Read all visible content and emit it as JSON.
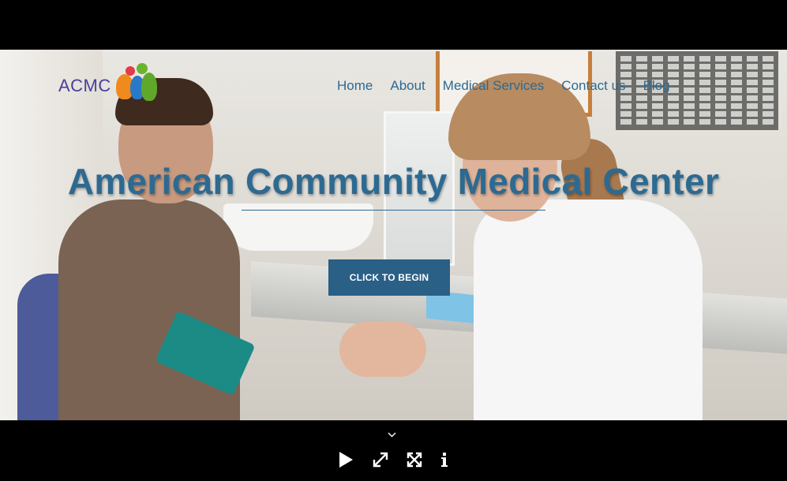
{
  "brand": {
    "logo_text": "ACMC"
  },
  "nav": {
    "items": [
      "Home",
      "About",
      "Medical Services",
      "Contact us",
      "Blog"
    ]
  },
  "hero": {
    "title": "American Community Medical Center",
    "cta_label": "CLICK TO BEGIN"
  },
  "player": {
    "controls": [
      "chevron-down-icon",
      "play-icon",
      "expand-icon",
      "fullscreen-icon",
      "info-icon"
    ]
  },
  "colors": {
    "nav_text": "#2b6a94",
    "title": "#2d6a92",
    "cta_bg": "#2a5f86",
    "logo_text": "#4a3f9a"
  }
}
